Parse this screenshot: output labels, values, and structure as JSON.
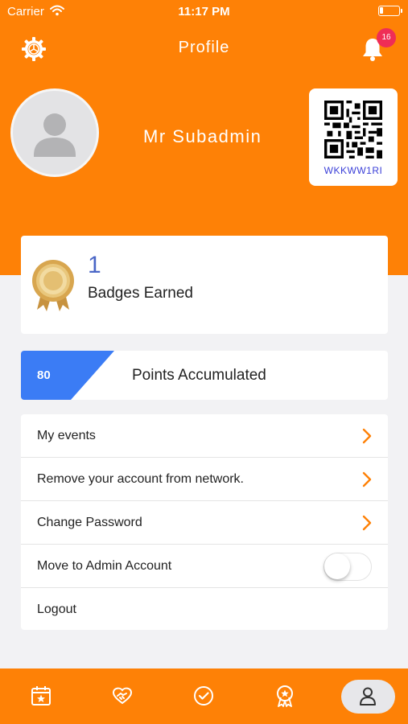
{
  "status_bar": {
    "carrier": "Carrier",
    "time": "11:17 PM"
  },
  "header": {
    "title": "Profile",
    "notification_count": "16",
    "user_name": "Mr Subadmin",
    "qr_code_text": "WKKWW1RI"
  },
  "badges": {
    "count": "1",
    "label": "Badges Earned"
  },
  "points": {
    "value": "80",
    "label": "Points Accumulated"
  },
  "menu": {
    "items": [
      {
        "label": "My events"
      },
      {
        "label": "Remove your account from network."
      },
      {
        "label": "Change Password"
      },
      {
        "label": "Move to Admin Account",
        "toggle": false
      },
      {
        "label": "Logout"
      }
    ]
  },
  "tabbar": {
    "icons": [
      "calendar-icon",
      "handshake-icon",
      "check-circle-icon",
      "award-icon",
      "user-icon"
    ],
    "active_tab": "user-icon"
  },
  "colors": {
    "header": "#fe8106",
    "points_accent": "#3b7cf5",
    "chevron": "#fe8106",
    "badge": "#ef2d56",
    "qr_label": "#3a3fd8"
  }
}
